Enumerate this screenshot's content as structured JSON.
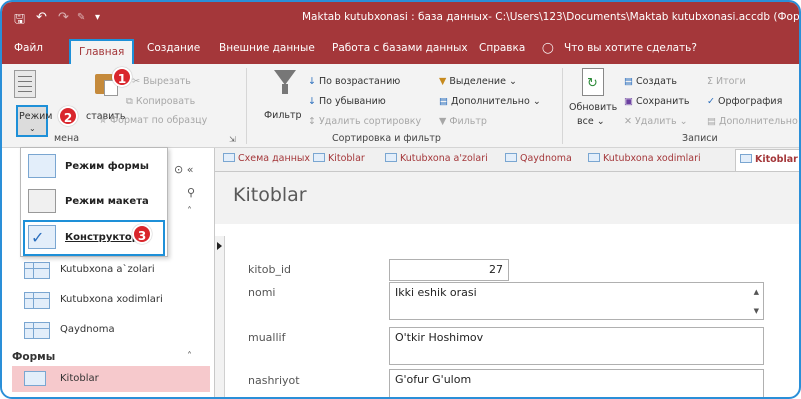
{
  "titlebar": {
    "title": "Maktab kutubxonasi : база данных- C:\\Users\\123\\Documents\\Maktab kutubxonasi.accdb (Формат ф",
    "save_icon": "save-icon",
    "undo_icon": "undo-icon",
    "redo_icon": "redo-icon"
  },
  "tabs": {
    "file": "Файл",
    "home": "Главная",
    "create": "Создание",
    "external": "Внешние данные",
    "database": "Работа с базами данных",
    "help": "Справка",
    "tellme": "Что вы хотите сделать?"
  },
  "ribbon": {
    "view_label": "Режим",
    "paste_label": "ставить",
    "cut": "Вырезать",
    "copy": "Копировать",
    "format_painter": "Формат по образцу",
    "clipboard_group": "мена",
    "filter": "Фильтр",
    "ascending": "По возрастанию",
    "descending": "По убыванию",
    "remove_sort": "Удалить сортировку",
    "selection": "Выделение",
    "advanced": "Дополнительно",
    "toggle_filter": "Фильтр",
    "sort_filter_group": "Сортировка и фильтр",
    "refresh_all": "Обновить",
    "refresh_all_2": "все",
    "new": "Создать",
    "save": "Сохранить",
    "delete": "Удалить",
    "totals": "Итоги",
    "spelling": "Орфография",
    "more": "Дополнительно",
    "records_group": "Записи"
  },
  "view_menu": {
    "items": [
      "Режим формы",
      "Режим макета",
      "Конструктор"
    ]
  },
  "nav": {
    "tables": [
      "Kutubxona a`zolari",
      "Kutubxona xodimlari",
      "Qaydnoma"
    ],
    "forms_section": "Формы",
    "forms": [
      "Kitoblar"
    ]
  },
  "doc_tabs": [
    "Схема данных",
    "Kitoblar",
    "Kutubxona a'zolari",
    "Qaydnoma",
    "Kutubxona xodimlari",
    "Kitoblar"
  ],
  "form": {
    "title": "Kitoblar",
    "fields": [
      {
        "label": "kitob_id",
        "value": "27"
      },
      {
        "label": "nomi",
        "value": "Ikki eshik orasi"
      },
      {
        "label": "muallif",
        "value": "O'tkir Hoshimov"
      },
      {
        "label": "nashriyot",
        "value": "G'ofur G'ulom"
      }
    ]
  },
  "callouts": [
    "1",
    "2",
    "3"
  ],
  "colors": {
    "accent": "#a4373a",
    "highlight": "#1e90d8",
    "badge": "#d9262c"
  }
}
